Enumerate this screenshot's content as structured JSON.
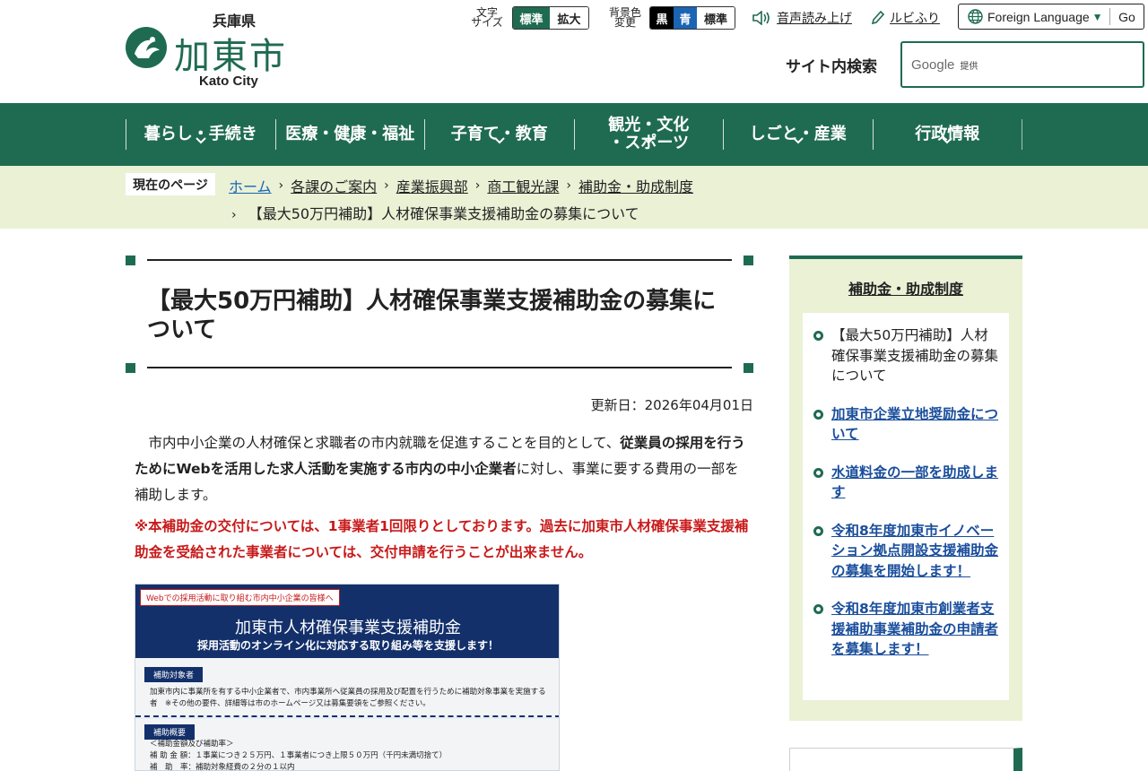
{
  "header": {
    "prefecture": "兵庫県",
    "city_name": "加東市",
    "city_en": "Kato City",
    "font_size": {
      "label": "文字\nサイズ",
      "standard": "標準",
      "large": "拡大"
    },
    "bg_color": {
      "label": "背景色\n変更",
      "black": "黒",
      "blue": "青",
      "standard": "標準"
    },
    "voice": "音声読み上げ",
    "ruby": "ルビふり",
    "language": {
      "label": "Foreign Language",
      "go": "Go"
    },
    "search": {
      "label": "サイト内検索",
      "google": "Google",
      "provided": "提供"
    }
  },
  "nav": {
    "items": [
      {
        "label": "暮らし・手続き"
      },
      {
        "label": "医療・健康・福祉"
      },
      {
        "label": "子育て・教育"
      },
      {
        "label": "観光・文化\n・スポーツ"
      },
      {
        "label": "しごと・産業"
      },
      {
        "label": "行政情報"
      }
    ],
    "chevron": "⌄"
  },
  "breadcrumb": {
    "here_label": "現在のページ",
    "items": [
      "ホーム",
      "各課のご案内",
      "産業振興部",
      "商工観光課",
      "補助金・助成制度"
    ],
    "current": "【最大50万円補助】人材確保事業支援補助金の募集について",
    "separator": "›"
  },
  "main": {
    "title": "【最大50万円補助】人材確保事業支援補助金の募集について",
    "updated": "更新日：2026年04月01日",
    "lead": {
      "p1": "　市内中小企業の人材確保と求職者の市内就職を促進することを目的として、",
      "p1_bold": "従業員の採用を行うためにWebを活用した求人活動を実施する市内の中小企業者",
      "p1_end": "に対し、事業に要する費用の一部を補助します。"
    },
    "notice": "※本補助金の交付については、1事業者1回限りとしております。過去に加東市人材確保事業支援補助金を受給された事業者については、交付申請を行うことが出来ません。",
    "poster": {
      "tag": "Webでの採用活動に取り組む市内中小企業の皆様へ",
      "title": "加東市人材確保事業支援補助金",
      "subtitle": "採用活動のオンライン化に対応する取り組み等を支援します！",
      "section1": "補助対象者",
      "section1_text": "加東市内に事業所を有する中小企業者で、市内事業所へ従業員の採用及び配置を行うために補助対象事業を実施する者　※その他の要件、詳細等は市のホームページ又は募集要領をご参照ください。",
      "section2": "補助概要",
      "section2_text": "＜補助金額及び補助率＞\n補 助 金 額：１事業につき２５万円、１事業者につき上限５０万円（千円未満切捨て）\n補　助　率：補助対象経費の２分の１以内"
    }
  },
  "sidebar": {
    "title": "補助金・助成制度",
    "items": [
      {
        "label": "【最大50万円補助】人材確保事業支援補助金の募集について",
        "current": true
      },
      {
        "label": "加東市企業立地奨励金について",
        "current": false
      },
      {
        "label": "水道料金の一部を助成します",
        "current": false
      },
      {
        "label": "令和8年度加東市イノベーション拠点開設支援補助金の募集を開始します！",
        "current": false
      },
      {
        "label": "令和8年度加東市創業者支援補助事業補助金の申請者を募集します！",
        "current": false
      }
    ]
  },
  "colors": {
    "brand_green": "#1f6b52",
    "breadcrumb_bg": "#eaf1d5",
    "notice_red": "#c81a1a",
    "link_blue": "#1a4e9c"
  }
}
